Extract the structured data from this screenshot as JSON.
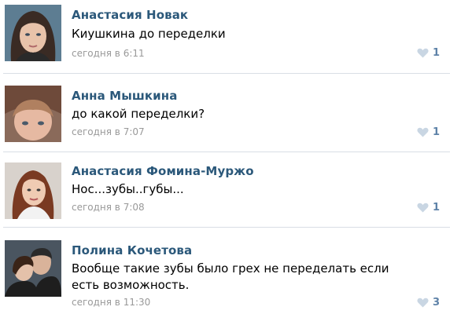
{
  "comments": [
    {
      "author": "Анастасия Новак",
      "text": "Киушкина до переделки",
      "time": "сегодня в 6:11",
      "likes": "1",
      "avatar_icon": "avatar-photo-woman"
    },
    {
      "author": "Анна Мышкина",
      "text": "до какой переделки?",
      "time": "сегодня в 7:07",
      "likes": "1",
      "avatar_icon": "avatar-photo-child"
    },
    {
      "author": "Анастасия Фомина-Муржо",
      "text": "Нос...зубы..губы...",
      "time": "сегодня в 7:08",
      "likes": "1",
      "avatar_icon": "avatar-photo-woman"
    },
    {
      "author": "Полина Кочетова",
      "text": "Вообще такие зубы было грех не переделать если есть возможность.",
      "time": "сегодня в 11:30",
      "likes": "3",
      "avatar_icon": "avatar-photo-couple"
    }
  ],
  "like_icon": "heart-icon",
  "colors": {
    "author": "#2b587a",
    "time": "#999999",
    "like": "#5e82a8",
    "heart": "#c9d6e3",
    "separator": "#d9dee5"
  }
}
